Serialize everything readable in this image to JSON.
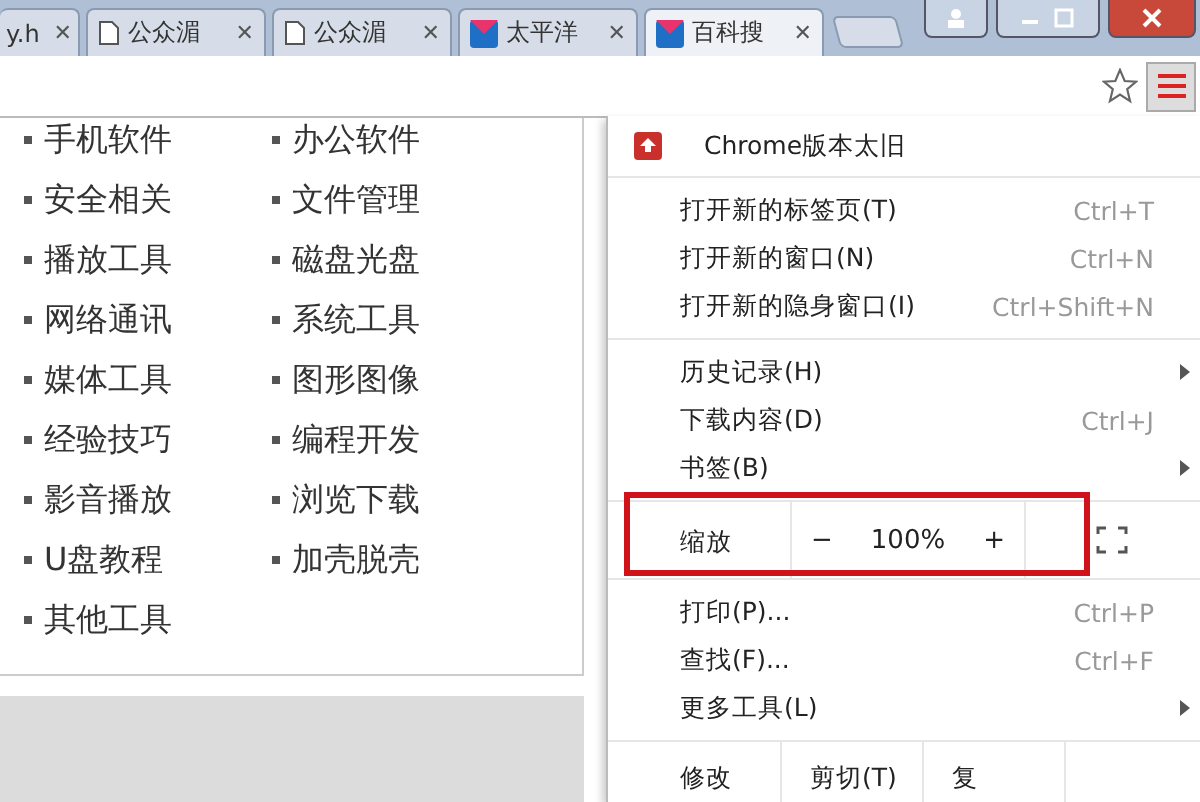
{
  "tabs": [
    {
      "title": "y.h",
      "kind": "none",
      "close": "✕",
      "selected": false
    },
    {
      "title": "公众湄",
      "kind": "page",
      "close": "✕",
      "selected": false
    },
    {
      "title": "公众湄",
      "kind": "page",
      "close": "✕",
      "selected": false
    },
    {
      "title": "太平洋",
      "kind": "logo",
      "close": "✕",
      "selected": false
    },
    {
      "title": "百科搜",
      "kind": "logo",
      "close": "✕",
      "selected": true
    }
  ],
  "categories": {
    "columns": [
      [
        "手机软件",
        "安全相关",
        "播放工具",
        "网络通讯",
        "媒体工具",
        "经验技巧",
        "影音播放",
        "U盘教程",
        "其他工具"
      ],
      [
        "办公软件",
        "文件管理",
        "磁盘光盘",
        "系统工具",
        "图形图像",
        "编程开发",
        "浏览下载",
        "加壳脱壳"
      ]
    ]
  },
  "menu": {
    "update": "Chrome版本太旧",
    "sections": [
      [
        {
          "label": "打开新的标签页(T)",
          "shortcut": "Ctrl+T",
          "submenu": false
        },
        {
          "label": "打开新的窗口(N)",
          "shortcut": "Ctrl+N",
          "submenu": false
        },
        {
          "label": "打开新的隐身窗口(I)",
          "shortcut": "Ctrl+Shift+N",
          "submenu": false
        }
      ],
      [
        {
          "label": "历史记录(H)",
          "submenu": true
        },
        {
          "label": "下载内容(D)",
          "shortcut": "Ctrl+J",
          "submenu": false
        },
        {
          "label": "书签(B)",
          "submenu": true
        }
      ],
      [
        {
          "label": "打印(P)...",
          "shortcut": "Ctrl+P",
          "submenu": false
        },
        {
          "label": "查找(F)...",
          "shortcut": "Ctrl+F",
          "submenu": false
        },
        {
          "label": "更多工具(L)",
          "submenu": true
        }
      ]
    ],
    "zoom": {
      "label": "缩放",
      "minus": "−",
      "value": "100%",
      "plus": "+",
      "highlighted": true
    },
    "edit": [
      "修改",
      "剪切(T)",
      "复"
    ]
  }
}
